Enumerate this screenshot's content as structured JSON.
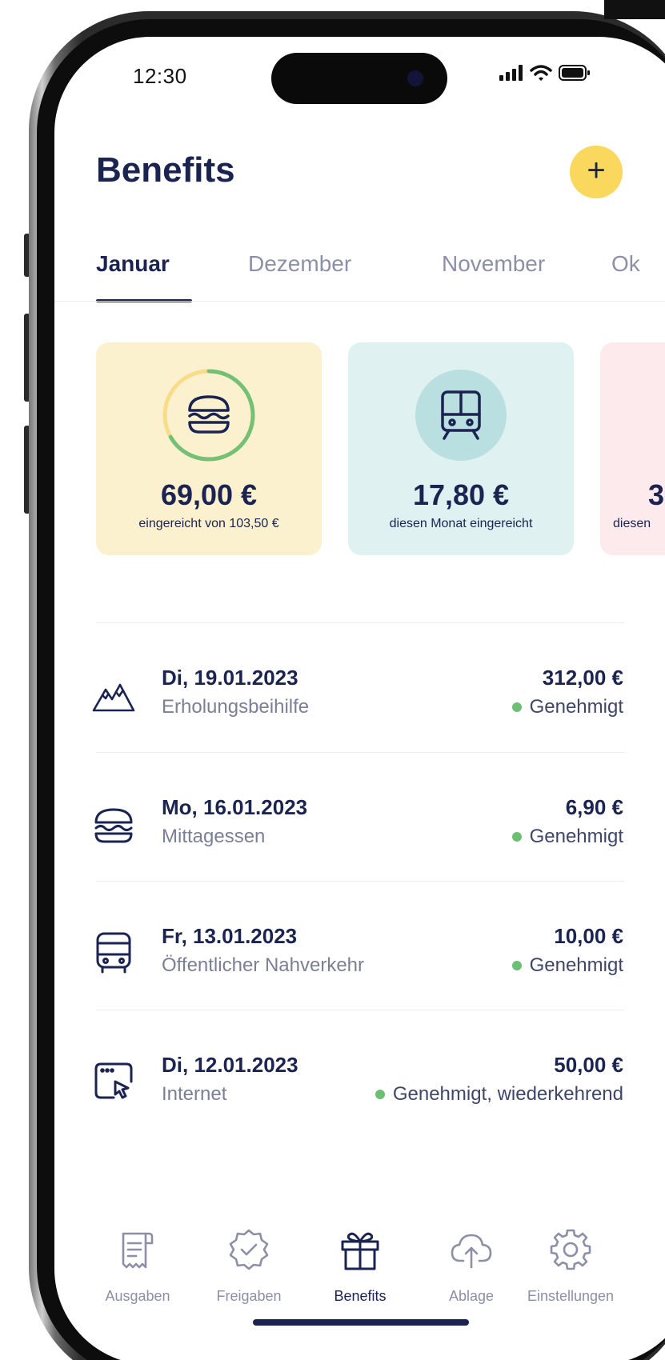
{
  "status_bar": {
    "time": "12:30"
  },
  "header": {
    "title": "Benefits",
    "add_label": "+"
  },
  "tabs": [
    {
      "label": "Januar",
      "active": true
    },
    {
      "label": "Dezember",
      "active": false
    },
    {
      "label": "November",
      "active": false
    },
    {
      "label": "Ok",
      "active": false
    }
  ],
  "cards": [
    {
      "amount": "69,00 €",
      "subtitle": "eingereicht von 103,50 €",
      "icon": "burger-icon",
      "color": "#fcf1cf",
      "progress": 0.667
    },
    {
      "amount": "17,80 €",
      "subtitle": "diesen Monat eingereicht",
      "icon": "train-icon",
      "color": "#e0f1f2"
    },
    {
      "amount": "3",
      "subtitle": "diesen",
      "color": "#fdeaec"
    }
  ],
  "transactions": [
    {
      "date": "Di, 19.01.2023",
      "category": "Erholungsbeihilfe",
      "amount": "312,00 €",
      "status": "Genehmigt",
      "icon": "mountain-icon"
    },
    {
      "date": "Mo, 16.01.2023",
      "category": "Mittagessen",
      "amount": "6,90 €",
      "status": "Genehmigt",
      "icon": "burger-icon"
    },
    {
      "date": "Fr, 13.01.2023",
      "category": "Öffentlicher Nahverkehr",
      "amount": "10,00 €",
      "status": "Genehmigt",
      "icon": "bus-icon"
    },
    {
      "date": "Di, 12.01.2023",
      "category": "Internet",
      "amount": "50,00 €",
      "status": "Genehmigt, wiederkehrend",
      "icon": "browser-cursor-icon"
    }
  ],
  "nav": [
    {
      "label": "Ausgaben",
      "icon": "receipt-icon",
      "active": false
    },
    {
      "label": "Freigaben",
      "icon": "approval-badge-icon",
      "active": false
    },
    {
      "label": "Benefits",
      "icon": "gift-icon",
      "active": true
    },
    {
      "label": "Ablage",
      "icon": "cloud-upload-icon",
      "active": false
    },
    {
      "label": "Einstellungen",
      "icon": "gear-icon",
      "active": false
    }
  ],
  "colors": {
    "primary": "#1b2450",
    "accent": "#f9d85d",
    "status_ok": "#6cbf74",
    "muted": "#8c8fa6"
  }
}
